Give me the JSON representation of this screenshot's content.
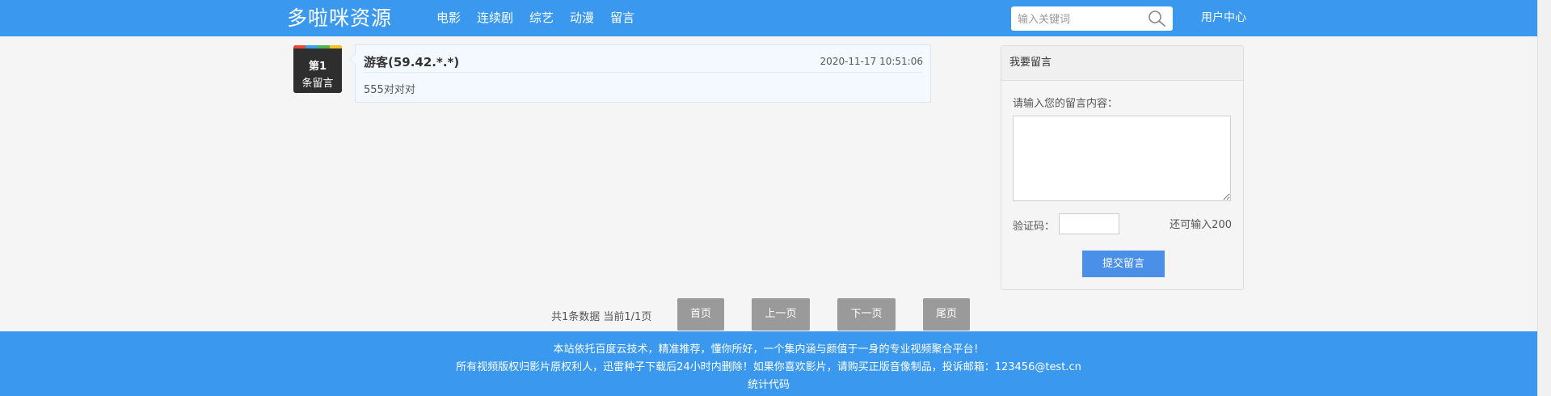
{
  "header": {
    "logo": "多啦咪资源",
    "nav": [
      "电影",
      "连续剧",
      "综艺",
      "动漫",
      "留言"
    ],
    "search_placeholder": "输入关键词",
    "user_center": "用户中心",
    "icon": "search-icon"
  },
  "message": {
    "badge_num": "第1",
    "badge_label": "条留言",
    "badge_colors": [
      "#e84a3a",
      "#3aa0ea",
      "#4cb84c",
      "#f5c020"
    ],
    "user": "游客(59.42.*.*)",
    "time": "2020-11-17 10:51:06",
    "content": "555对对对"
  },
  "form": {
    "title": "我要留言",
    "prompt": "请输入您的留言内容：",
    "captcha_label": "验证码：",
    "remaining": "还可输入200",
    "submit": "提交留言",
    "textarea_value": "",
    "captcha_value": ""
  },
  "pagination": {
    "info": "共1条数据 当前1/1页",
    "first": "首页",
    "prev": "上一页",
    "next": "下一页",
    "last": "尾页"
  },
  "footer": {
    "line1": "本站依托百度云技术，精准推荐，懂你所好，一个集内涵与颜值于一身的专业视频聚合平台！",
    "line2": "所有视频版权归影片原权利人，迅雷种子下载后24小时内删除！如果你喜欢影片，请购买正版音像制品，投诉邮箱：123456@test.cn",
    "line3": "统计代码"
  },
  "colors": {
    "brand": "#3a99ee",
    "submit": "#4a8fe8",
    "page_button": "#9a9a9a"
  }
}
